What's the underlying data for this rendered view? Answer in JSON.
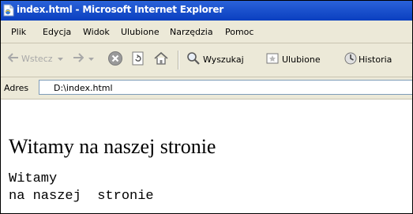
{
  "window": {
    "title": "index.html - Microsoft Internet Explorer"
  },
  "menu": {
    "items": [
      "Plik",
      "Edycja",
      "Widok",
      "Ulubione",
      "Narzędzia",
      "Pomoc"
    ]
  },
  "toolbar": {
    "back_label": "Wstecz",
    "search_label": "Wyszukaj",
    "favorites_label": "Ulubione",
    "history_label": "Historia"
  },
  "address": {
    "label": "Adres",
    "value": "D:\\index.html"
  },
  "page": {
    "heading": "Witamy na naszej stronie",
    "pre_line1": "Witamy",
    "pre_line2": "na naszej  stronie"
  },
  "colors": {
    "titlebar": "#0a3fc0",
    "chrome": "#ece9d8"
  }
}
